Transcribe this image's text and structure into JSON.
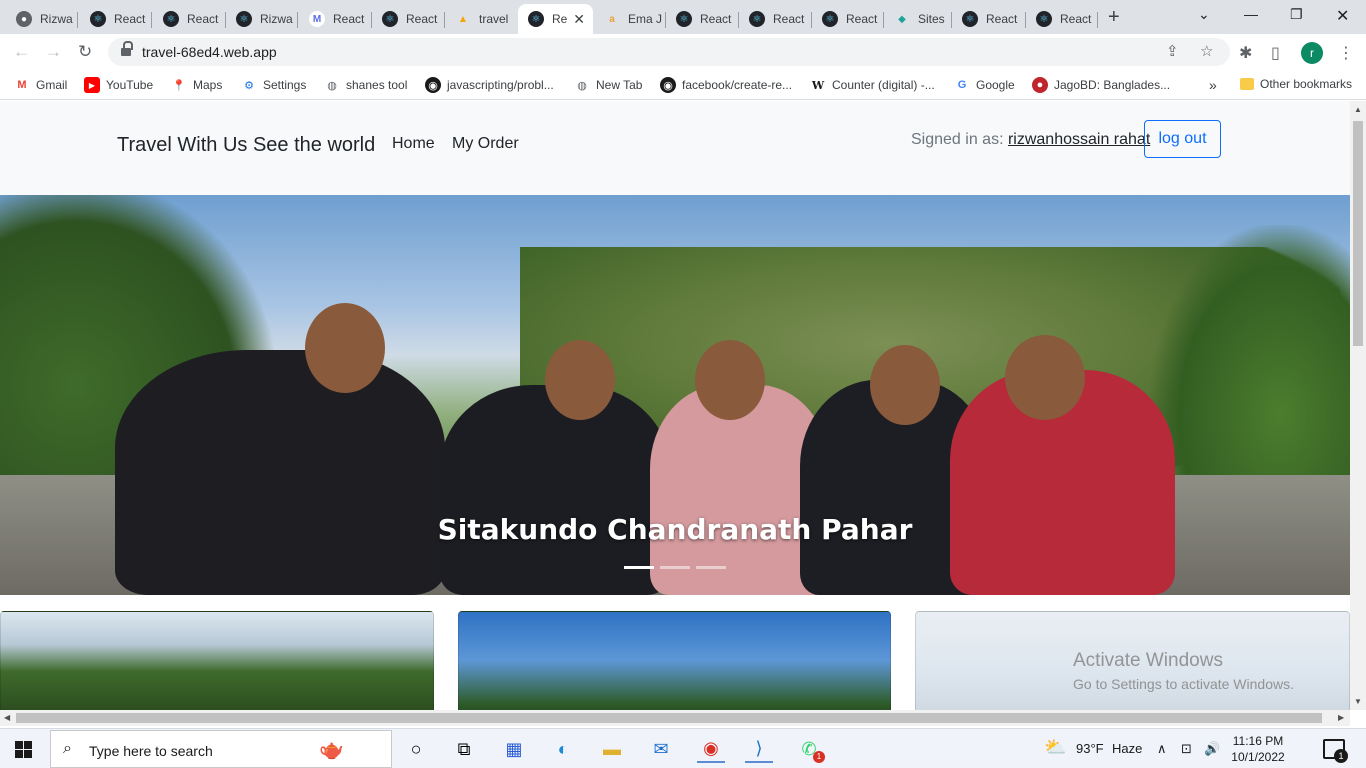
{
  "browser": {
    "tabs": [
      {
        "title": "Rizwa",
        "icon": "globe-icon"
      },
      {
        "title": "React",
        "icon": "react-icon"
      },
      {
        "title": "React",
        "icon": "react-icon"
      },
      {
        "title": "Rizwa",
        "icon": "react-icon"
      },
      {
        "title": "React",
        "icon": "ms-icon"
      },
      {
        "title": "React",
        "icon": "react-icon"
      },
      {
        "title": "travel",
        "icon": "firebase-icon"
      },
      {
        "title": "Re",
        "icon": "react-icon",
        "active": true
      },
      {
        "title": "Ema J",
        "icon": "amazon-icon"
      },
      {
        "title": "React",
        "icon": "react-icon"
      },
      {
        "title": "React",
        "icon": "react-icon"
      },
      {
        "title": "React",
        "icon": "react-icon"
      },
      {
        "title": "Sites",
        "icon": "sites-icon"
      },
      {
        "title": "React",
        "icon": "react-icon"
      },
      {
        "title": "React",
        "icon": "react-icon"
      }
    ],
    "url": "travel-68ed4.web.app",
    "profile_initial": "r",
    "bookmarks": [
      {
        "label": "Gmail",
        "icon": "gmail-icon"
      },
      {
        "label": "YouTube",
        "icon": "youtube-icon"
      },
      {
        "label": "Maps",
        "icon": "maps-icon"
      },
      {
        "label": "Settings",
        "icon": "gear-icon"
      },
      {
        "label": "shanes tool",
        "icon": "globe-icon"
      },
      {
        "label": "javascripting/probl...",
        "icon": "github-icon"
      },
      {
        "label": "New Tab",
        "icon": "globe-icon"
      },
      {
        "label": "facebook/create-re...",
        "icon": "github-icon"
      },
      {
        "label": "Counter (digital) -...",
        "icon": "wikipedia-icon"
      },
      {
        "label": "Google",
        "icon": "google-icon"
      },
      {
        "label": "JagoBD: Banglades...",
        "icon": "jagobd-icon"
      }
    ],
    "other_bookmarks": "Other bookmarks",
    "more_bookmarks": "»"
  },
  "page": {
    "brand": "Travel With Us See the world",
    "nav": [
      "Home",
      "My Order"
    ],
    "signed_in_label": "Signed in as:",
    "username": "rizwanhossain rahat",
    "logout_label": "log out",
    "carousel": {
      "caption": "Sitakundo Chandranath Pahar",
      "slide_count": 3,
      "active_slide": 1
    }
  },
  "watermark": {
    "title": "Activate Windows",
    "subtitle": "Go to Settings to activate Windows."
  },
  "taskbar": {
    "search_placeholder": "Type here to search",
    "weather_temp": "93°F",
    "weather_desc": "Haze",
    "time": "11:16 PM",
    "date": "10/1/2022",
    "notification_count": "1",
    "whatsapp_badge": "1"
  },
  "colors": {
    "primary": "#0d6efd",
    "navbar_bg": "#f8f9fa",
    "chrome_tabstrip": "#dee1e6"
  }
}
